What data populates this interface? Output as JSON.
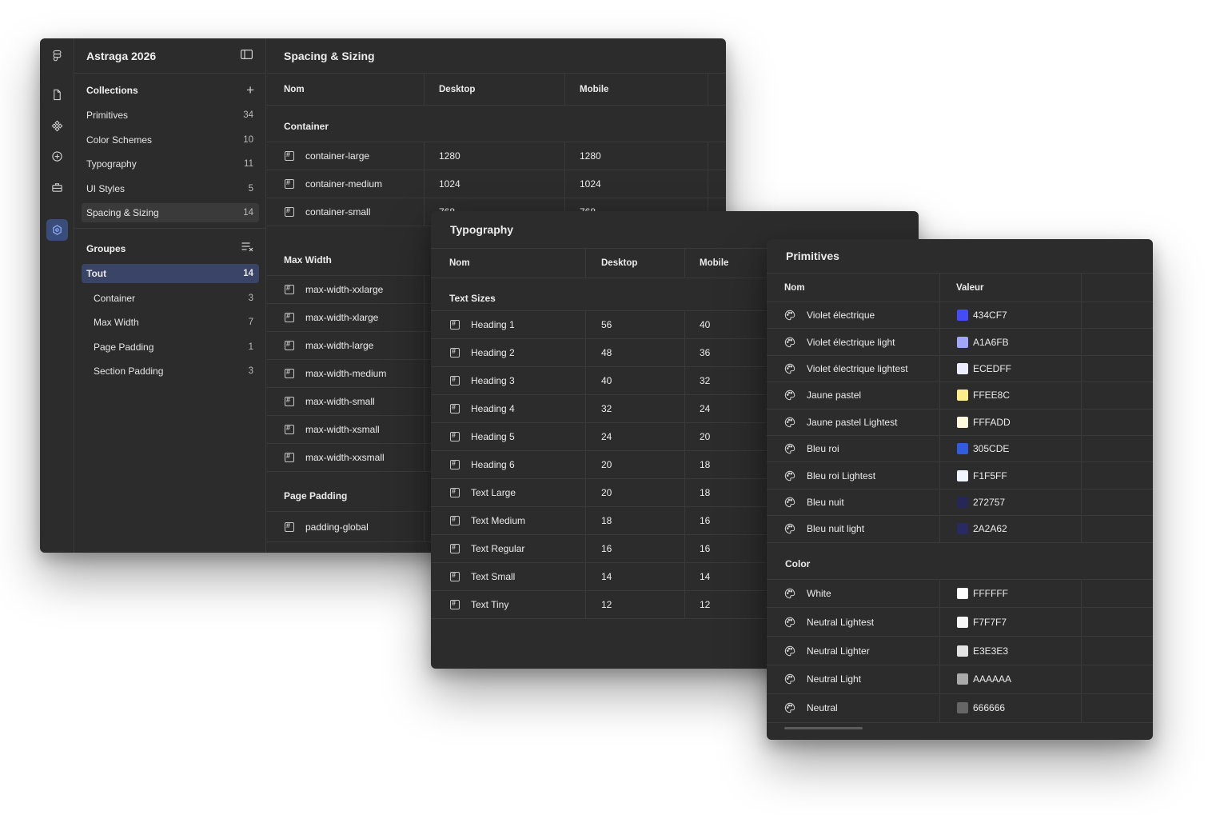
{
  "app": {
    "title": "Astraga 2026"
  },
  "sidebar": {
    "collections_title": "Collections",
    "collections": [
      {
        "label": "Primitives",
        "count": "34"
      },
      {
        "label": "Color Schemes",
        "count": "10"
      },
      {
        "label": "Typography",
        "count": "11"
      },
      {
        "label": "UI Styles",
        "count": "5"
      },
      {
        "label": "Spacing & Sizing",
        "count": "14",
        "selected": true
      }
    ],
    "groups_title": "Groupes",
    "groups": [
      {
        "label": "Tout",
        "count": "14",
        "selected": true
      },
      {
        "label": "Container",
        "count": "3"
      },
      {
        "label": "Max Width",
        "count": "7"
      },
      {
        "label": "Page Padding",
        "count": "1"
      },
      {
        "label": "Section Padding",
        "count": "3"
      }
    ]
  },
  "spacing": {
    "title": "Spacing & Sizing",
    "columns": [
      "Nom",
      "Desktop",
      "Mobile"
    ],
    "groups": [
      {
        "name": "Container",
        "rows": [
          {
            "name": "container-large",
            "desktop": "1280",
            "mobile": "1280"
          },
          {
            "name": "container-medium",
            "desktop": "1024",
            "mobile": "1024"
          },
          {
            "name": "container-small",
            "desktop": "768",
            "mobile": "768"
          }
        ]
      },
      {
        "name": "Max Width",
        "rows": [
          {
            "name": "max-width-xxlarge",
            "desktop": "",
            "mobile": ""
          },
          {
            "name": "max-width-xlarge",
            "desktop": "",
            "mobile": ""
          },
          {
            "name": "max-width-large",
            "desktop": "",
            "mobile": ""
          },
          {
            "name": "max-width-medium",
            "desktop": "",
            "mobile": ""
          },
          {
            "name": "max-width-small",
            "desktop": "",
            "mobile": ""
          },
          {
            "name": "max-width-xsmall",
            "desktop": "",
            "mobile": ""
          },
          {
            "name": "max-width-xxsmall",
            "desktop": "",
            "mobile": ""
          }
        ]
      },
      {
        "name": "Page Padding",
        "rows": [
          {
            "name": "padding-global",
            "desktop": "",
            "mobile": ""
          }
        ]
      }
    ]
  },
  "typography": {
    "title": "Typography",
    "columns": [
      "Nom",
      "Desktop",
      "Mobile"
    ],
    "group": "Text Sizes",
    "rows": [
      {
        "name": "Heading 1",
        "desktop": "56",
        "mobile": "40"
      },
      {
        "name": "Heading 2",
        "desktop": "48",
        "mobile": "36"
      },
      {
        "name": "Heading 3",
        "desktop": "40",
        "mobile": "32"
      },
      {
        "name": "Heading 4",
        "desktop": "32",
        "mobile": "24"
      },
      {
        "name": "Heading 5",
        "desktop": "24",
        "mobile": "20"
      },
      {
        "name": "Heading 6",
        "desktop": "20",
        "mobile": "18"
      },
      {
        "name": "Text Large",
        "desktop": "20",
        "mobile": "18"
      },
      {
        "name": "Text Medium",
        "desktop": "18",
        "mobile": "16"
      },
      {
        "name": "Text Regular",
        "desktop": "16",
        "mobile": "16"
      },
      {
        "name": "Text Small",
        "desktop": "14",
        "mobile": "14"
      },
      {
        "name": "Text Tiny",
        "desktop": "12",
        "mobile": "12"
      }
    ]
  },
  "primitives": {
    "title": "Primitives",
    "columns": [
      "Nom",
      "Valeur"
    ],
    "rows": [
      {
        "name": "Violet électrique",
        "value": "434CF7",
        "color": "#434CF7"
      },
      {
        "name": "Violet électrique light",
        "value": "A1A6FB",
        "color": "#A1A6FB"
      },
      {
        "name": "Violet électrique lightest",
        "value": "ECEDFF",
        "color": "#ECEDFF"
      },
      {
        "name": "Jaune pastel",
        "value": "FFEE8C",
        "color": "#FFEE8C"
      },
      {
        "name": "Jaune pastel Lightest",
        "value": "FFFADD",
        "color": "#FFFADD"
      },
      {
        "name": "Bleu roi",
        "value": "305CDE",
        "color": "#305CDE"
      },
      {
        "name": "Bleu roi Lightest",
        "value": "F1F5FF",
        "color": "#F1F5FF"
      },
      {
        "name": "Bleu nuit",
        "value": "272757",
        "color": "#272757"
      },
      {
        "name": "Bleu nuit light",
        "value": "2A2A62",
        "color": "#2A2A62"
      }
    ],
    "color_group": "Color",
    "color_rows": [
      {
        "name": "White",
        "value": "FFFFFF",
        "color": "#FFFFFF"
      },
      {
        "name": "Neutral Lightest",
        "value": "F7F7F7",
        "color": "#F7F7F7"
      },
      {
        "name": "Neutral Lighter",
        "value": "E3E3E3",
        "color": "#E3E3E3"
      },
      {
        "name": "Neutral Light",
        "value": "AAAAAA",
        "color": "#AAAAAA"
      },
      {
        "name": "Neutral",
        "value": "666666",
        "color": "#666666"
      }
    ]
  }
}
